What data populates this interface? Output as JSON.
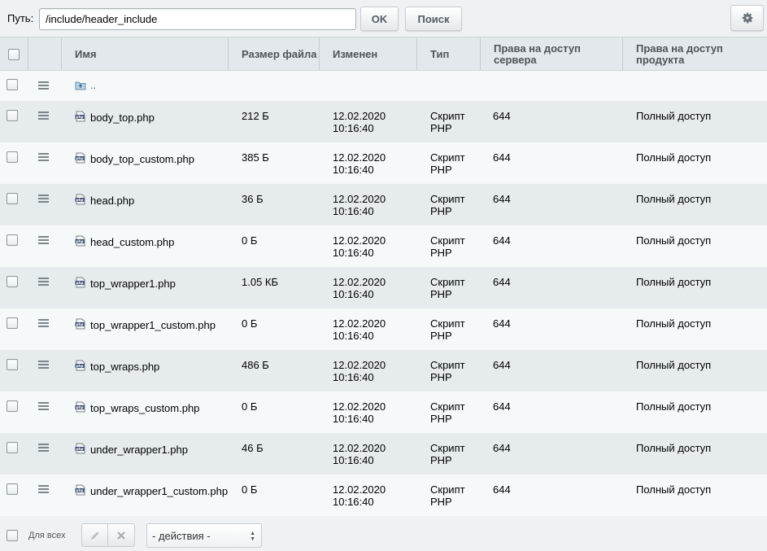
{
  "toolbar": {
    "path_label": "Путь:",
    "path_value": "/include/header_include",
    "ok_label": "OK",
    "search_label": "Поиск"
  },
  "columns": {
    "name": "Имя",
    "size": "Размер файла",
    "modified": "Изменен",
    "type": "Тип",
    "server_rights": "Права на доступ сервера",
    "product_rights": "Права на доступ продукта"
  },
  "parent_link": "..",
  "rows": [
    {
      "name": "body_top.php",
      "size": "212 Б",
      "date": "12.02.2020",
      "time": "10:16:40",
      "type1": "Скрипт",
      "type2": "PHP",
      "server": "644",
      "product": "Полный доступ"
    },
    {
      "name": "body_top_custom.php",
      "size": "385 Б",
      "date": "12.02.2020",
      "time": "10:16:40",
      "type1": "Скрипт",
      "type2": "PHP",
      "server": "644",
      "product": "Полный доступ"
    },
    {
      "name": "head.php",
      "size": "36 Б",
      "date": "12.02.2020",
      "time": "10:16:40",
      "type1": "Скрипт",
      "type2": "PHP",
      "server": "644",
      "product": "Полный доступ"
    },
    {
      "name": "head_custom.php",
      "size": "0 Б",
      "date": "12.02.2020",
      "time": "10:16:40",
      "type1": "Скрипт",
      "type2": "PHP",
      "server": "644",
      "product": "Полный доступ"
    },
    {
      "name": "top_wrapper1.php",
      "size": "1.05 КБ",
      "date": "12.02.2020",
      "time": "10:16:40",
      "type1": "Скрипт",
      "type2": "PHP",
      "server": "644",
      "product": "Полный доступ"
    },
    {
      "name": "top_wrapper1_custom.php",
      "size": "0 Б",
      "date": "12.02.2020",
      "time": "10:16:40",
      "type1": "Скрипт",
      "type2": "PHP",
      "server": "644",
      "product": "Полный доступ"
    },
    {
      "name": "top_wraps.php",
      "size": "486 Б",
      "date": "12.02.2020",
      "time": "10:16:40",
      "type1": "Скрипт",
      "type2": "PHP",
      "server": "644",
      "product": "Полный доступ"
    },
    {
      "name": "top_wraps_custom.php",
      "size": "0 Б",
      "date": "12.02.2020",
      "time": "10:16:40",
      "type1": "Скрипт",
      "type2": "PHP",
      "server": "644",
      "product": "Полный доступ"
    },
    {
      "name": "under_wrapper1.php",
      "size": "46 Б",
      "date": "12.02.2020",
      "time": "10:16:40",
      "type1": "Скрипт",
      "type2": "PHP",
      "server": "644",
      "product": "Полный доступ"
    },
    {
      "name": "under_wrapper1_custom.php",
      "size": "0 Б",
      "date": "12.02.2020",
      "time": "10:16:40",
      "type1": "Скрипт",
      "type2": "PHP",
      "server": "644",
      "product": "Полный доступ"
    }
  ],
  "footer": {
    "for_all_label": "Для всех",
    "actions_label": "- действия -"
  },
  "icons": {
    "settings": "gear-icon",
    "row_menu": "hamburger-icon",
    "file": "php-file-icon",
    "parent": "folder-up-icon",
    "edit": "pencil-icon",
    "delete": "close-icon"
  }
}
